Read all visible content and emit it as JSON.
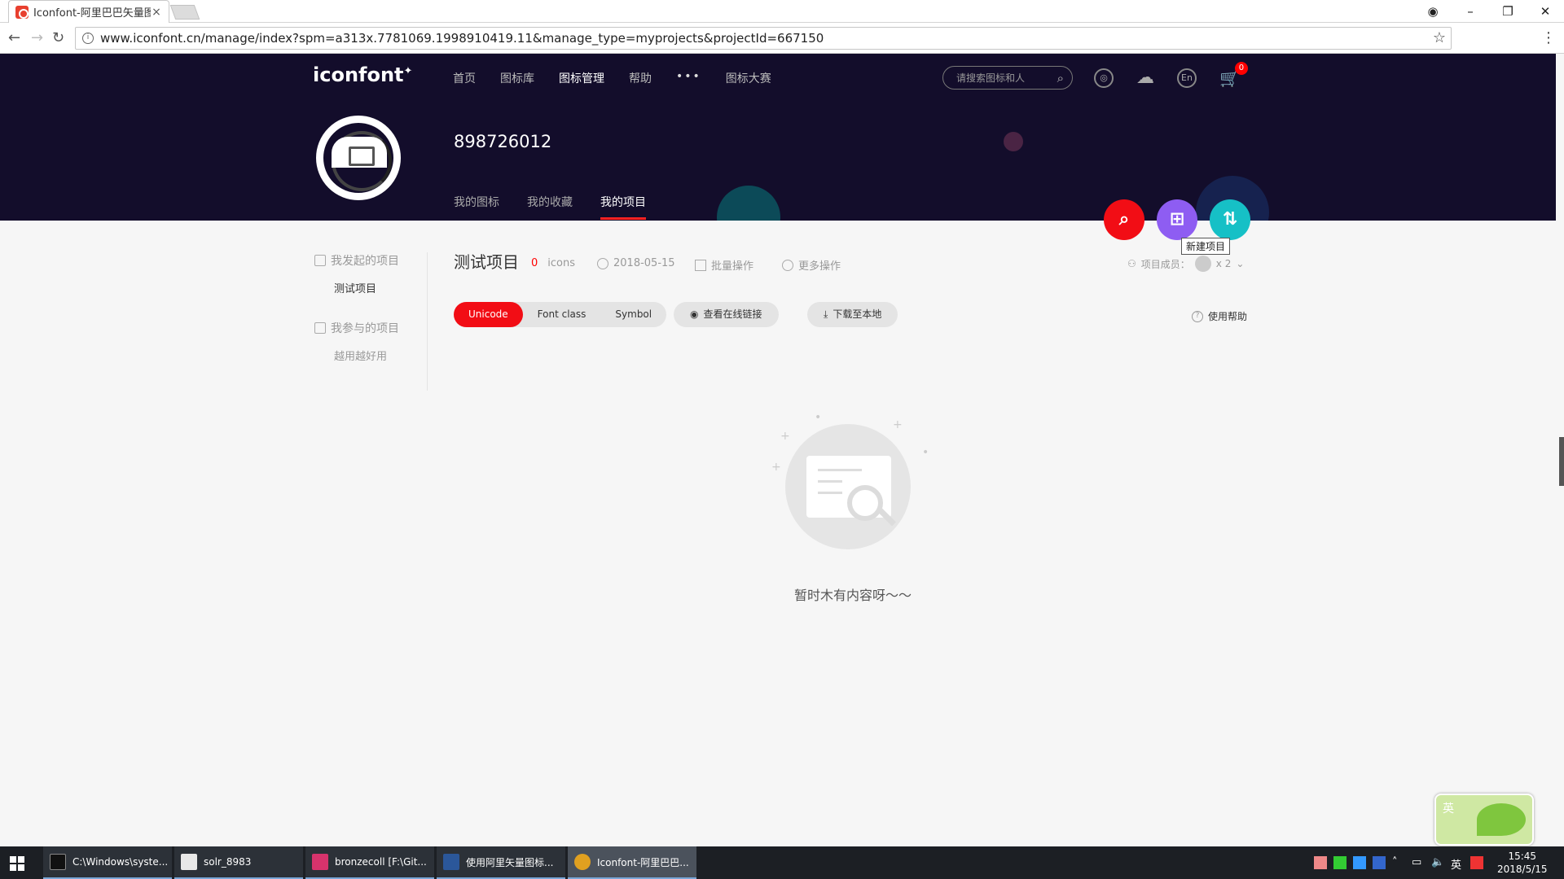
{
  "browser": {
    "tab_title": "Iconfont-阿里巴巴矢量图",
    "tab_close": "×",
    "url": "www.iconfont.cn/manage/index?spm=a313x.7781069.1998910419.11&manage_type=myprojects&projectId=667150"
  },
  "header": {
    "logo": "iconfont",
    "nav": [
      "首页",
      "图标库",
      "图标管理",
      "帮助",
      "图标大赛"
    ],
    "nav_more": "•••",
    "search_placeholder": "请搜索图标和人",
    "lang_btn": "En",
    "cart_count": "0",
    "username": "898726012",
    "tabs": [
      "我的图标",
      "我的收藏",
      "我的项目"
    ]
  },
  "fab": {
    "new_project_tooltip": "新建项目"
  },
  "sidebar": {
    "group1": "我发起的项目",
    "item1": "测试项目",
    "group2": "我参与的项目",
    "item2": "越用越好用"
  },
  "project": {
    "title": "测试项目",
    "icon_count": "0",
    "icon_unit": "icons",
    "date": "2018-05-15",
    "batch": "批量操作",
    "more": "更多操作",
    "members_label": "项目成员：",
    "members_count": "x 2",
    "modes": [
      "Unicode",
      "Font class",
      "Symbol"
    ],
    "view_link": "查看在线链接",
    "download": "下载至本地",
    "help": "使用帮助",
    "empty_text": "暂时木有内容呀～～"
  },
  "taskbar": {
    "items": [
      "C:\\Windows\\syste...",
      "solr_8983",
      "bronzecoll [F:\\Git...",
      "使用阿里矢量图标...",
      "Iconfont-阿里巴巴..."
    ],
    "ime": "英",
    "time": "15:45",
    "date": "2018/5/15"
  },
  "colors": {
    "header_bg": "#130d2b",
    "accent_red": "#f20d15",
    "fab_purple": "#8e5df2",
    "fab_teal": "#16c0c6"
  }
}
